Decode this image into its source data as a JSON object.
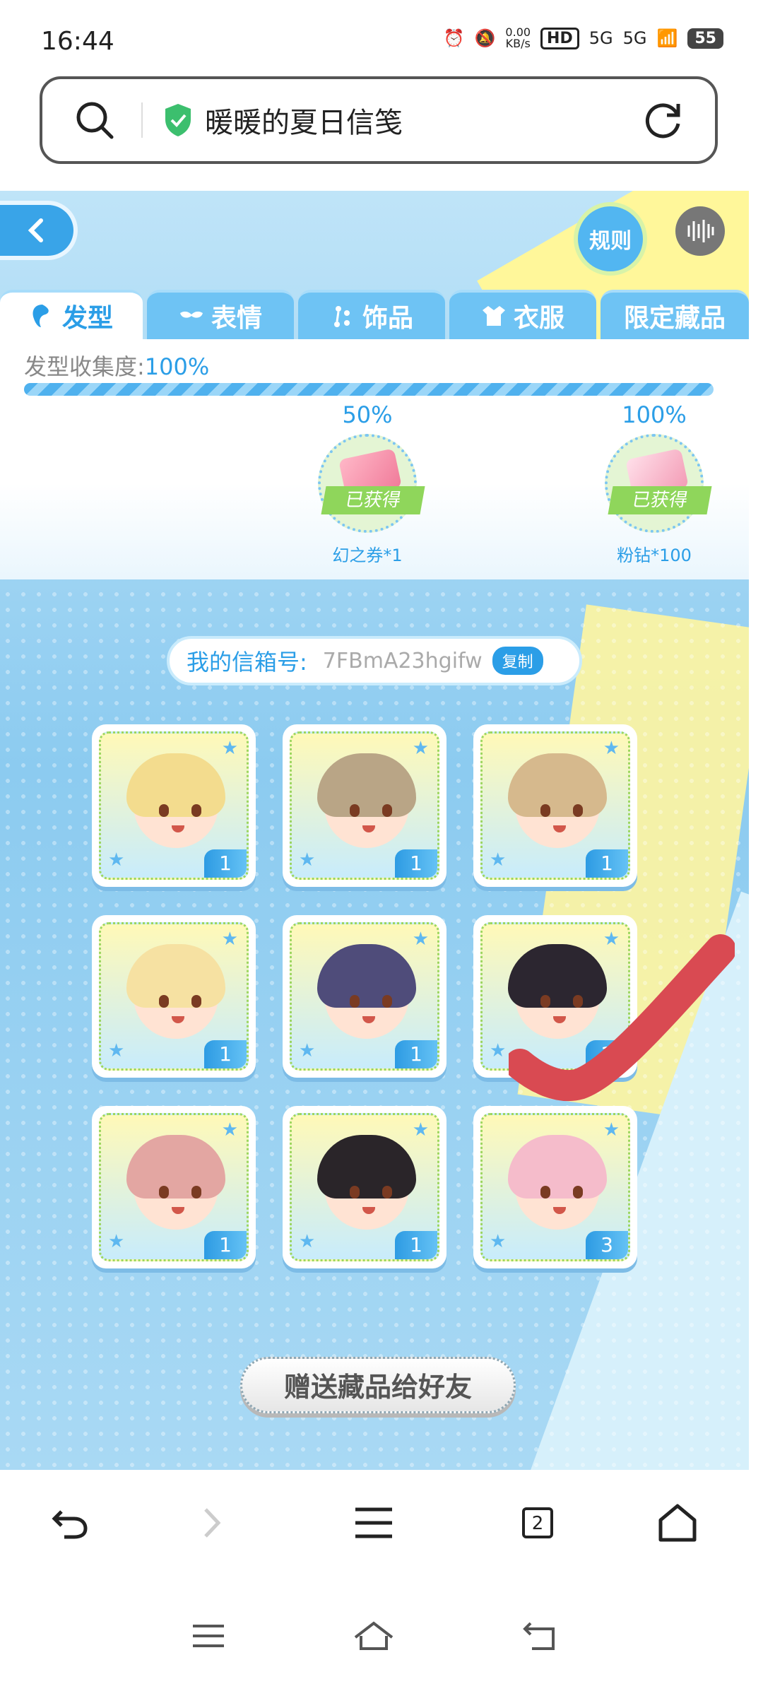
{
  "status_bar": {
    "time": "16:44",
    "net_speed_top": "0.00",
    "net_speed_unit": "KB/s",
    "hd": "HD",
    "sim1": "5G",
    "sim2": "5G",
    "battery": "55"
  },
  "url_bar": {
    "title": "暖暖的夏日信笺"
  },
  "game": {
    "rules_label": "规则",
    "tabs": [
      {
        "label": "发型",
        "active": true
      },
      {
        "label": "表情",
        "active": false
      },
      {
        "label": "饰品",
        "active": false
      },
      {
        "label": "衣服",
        "active": false
      },
      {
        "label": "限定藏品",
        "active": false
      }
    ],
    "collection_label": "发型收集度:",
    "collection_value": "100%",
    "progress": 1.0,
    "milestones": [
      {
        "percent": "50%",
        "status": "已获得",
        "reward": "幻之券*1"
      },
      {
        "percent": "100%",
        "status": "已获得",
        "reward": "粉钻*100"
      }
    ],
    "mailbox_label": "我的信箱号:",
    "mailbox_value": "7FBmA23hgifw",
    "copy_label": "复制",
    "items": [
      {
        "count": "1",
        "hair_color": "#f3dc8e"
      },
      {
        "count": "1",
        "hair_color": "#b9a586"
      },
      {
        "count": "1",
        "hair_color": "#d6b98d"
      },
      {
        "count": "1",
        "hair_color": "#f6e1a2"
      },
      {
        "count": "1",
        "hair_color": "#4f4c7a"
      },
      {
        "count": "1",
        "hair_color": "#2c2630"
      },
      {
        "count": "1",
        "hair_color": "#e3a6a2"
      },
      {
        "count": "1",
        "hair_color": "#2a2529"
      },
      {
        "count": "3",
        "hair_color": "#f5bccb"
      }
    ],
    "gift_button": "赠送藏品给好友",
    "annotation_color": "#d94a52"
  },
  "browser_nav": {
    "tab_count": "2"
  }
}
